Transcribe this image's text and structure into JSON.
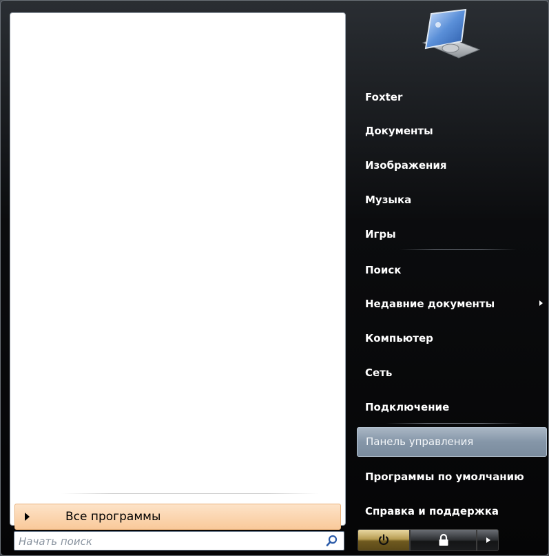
{
  "left_pane": {
    "all_programs_label": "Все программы",
    "search_placeholder": "Начать поиск"
  },
  "right_pane": {
    "items": [
      {
        "label": "Foxter"
      },
      {
        "label": "Документы"
      },
      {
        "label": "Изображения"
      },
      {
        "label": "Музыка"
      },
      {
        "label": "Игры"
      },
      {
        "label": "Поиск"
      },
      {
        "label": "Недавние документы",
        "has_submenu": true
      },
      {
        "label": "Компьютер"
      },
      {
        "label": "Сеть"
      },
      {
        "label": "Подключение"
      },
      {
        "label": "Панель управления",
        "selected": true
      },
      {
        "label": "Программы по умолчанию"
      },
      {
        "label": "Справка и поддержка"
      }
    ]
  },
  "icons": {
    "user_picture": "user-picture-icon",
    "search": "search-icon",
    "power": "power-icon",
    "lock": "lock-icon",
    "more": "arrow-right-icon"
  },
  "colors": {
    "selected_item": "#8596a8",
    "all_programs_bg": "#f9c99a",
    "power_button": "#b79d52"
  }
}
